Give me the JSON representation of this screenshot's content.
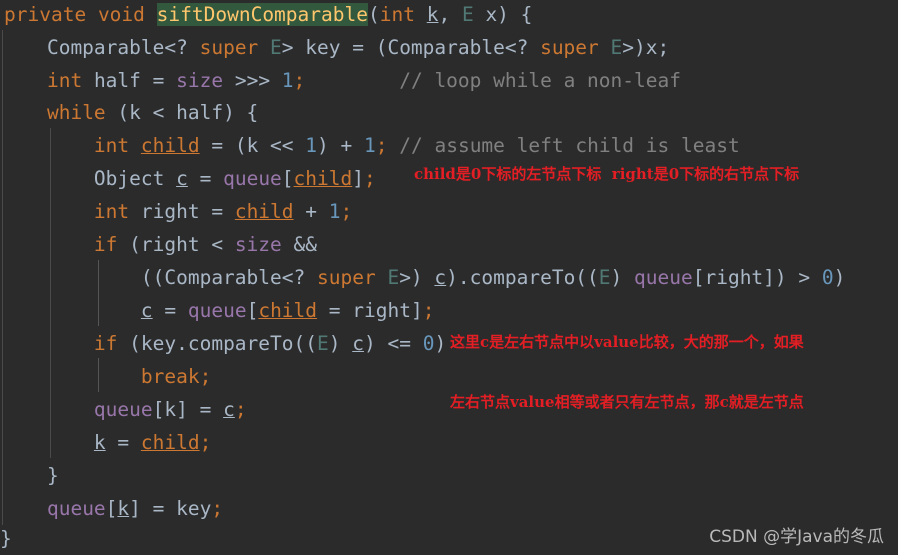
{
  "editor": {
    "background": "#2b2b2b",
    "default_text_color": "#a9b7c6",
    "keyword_color": "#cc7832",
    "number_color": "#6897bb",
    "field_color": "#9876aa",
    "comment_color": "#808080",
    "method_name_color": "#ffc66d",
    "method_name_highlight": "#32593d",
    "type_param_color": "#507874",
    "annotation_color": "#e31e24",
    "language": "Java"
  },
  "code": {
    "lines": [
      {
        "n": 1,
        "indent": 0,
        "text": "private void siftDownComparable(int k, E x) {"
      },
      {
        "n": 2,
        "indent": 1,
        "text": "Comparable<? super E> key = (Comparable<? super E>)x;"
      },
      {
        "n": 3,
        "indent": 1,
        "text": "int half = size >>> 1;        // loop while a non-leaf"
      },
      {
        "n": 4,
        "indent": 1,
        "text": "while (k < half) {"
      },
      {
        "n": 5,
        "indent": 2,
        "text": "int child = (k << 1) + 1; // assume left child is least"
      },
      {
        "n": 6,
        "indent": 2,
        "text": "Object c = queue[child];"
      },
      {
        "n": 7,
        "indent": 2,
        "text": "int right = child + 1;"
      },
      {
        "n": 8,
        "indent": 2,
        "text": "if (right < size &&"
      },
      {
        "n": 9,
        "indent": 3,
        "text": "((Comparable<? super E>) c).compareTo((E) queue[right]) > 0)"
      },
      {
        "n": 10,
        "indent": 3,
        "text": "c = queue[child = right];"
      },
      {
        "n": 11,
        "indent": 2,
        "text": "if (key.compareTo((E) c) <= 0)"
      },
      {
        "n": 12,
        "indent": 3,
        "text": "break;"
      },
      {
        "n": 13,
        "indent": 2,
        "text": "queue[k] = c;"
      },
      {
        "n": 14,
        "indent": 2,
        "text": "k = child;"
      },
      {
        "n": 15,
        "indent": 1,
        "text": "}"
      },
      {
        "n": 16,
        "indent": 1,
        "text": "queue[k] = key;"
      },
      {
        "n": 17,
        "indent": 0,
        "text": "}"
      }
    ],
    "method_name": "siftDownComparable",
    "comments": [
      "// loop while a non-leaf",
      "// assume left child is least"
    ]
  },
  "annotations": {
    "child_note": "child是0下标的左节点下标  right是0下标的右节点下标",
    "c_note_line1": "这里c是左右节点中以value比较，大的那一个，如果",
    "c_note_line2": "左右节点value相等或者只有左节点，那c就是左节点"
  },
  "watermark": {
    "text": "CSDN @学Java的冬瓜"
  }
}
